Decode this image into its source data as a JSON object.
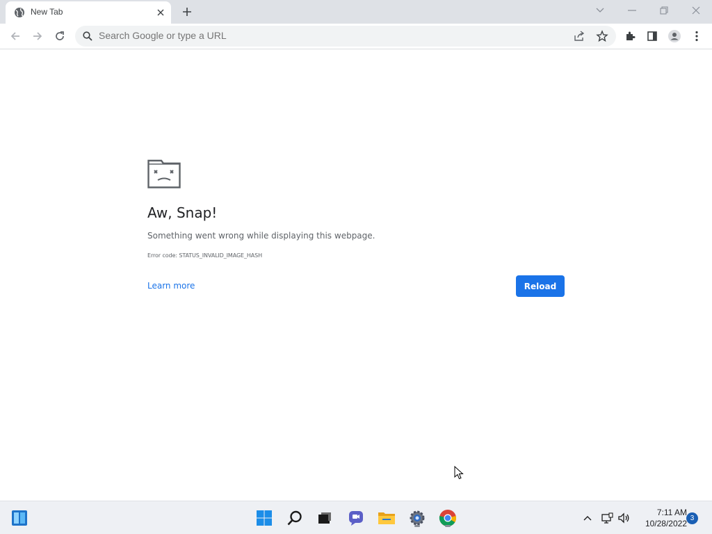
{
  "browser": {
    "tab": {
      "title": "New Tab",
      "favicon": "globe-icon"
    },
    "omnibox": {
      "placeholder": "Search Google or type a URL",
      "value": ""
    }
  },
  "error_page": {
    "heading": "Aw, Snap!",
    "message": "Something went wrong while displaying this webpage.",
    "error_code": "Error code: STATUS_INVALID_IMAGE_HASH",
    "learn_more": "Learn more",
    "reload_label": "Reload",
    "accent_color": "#1a73e8"
  },
  "taskbar": {
    "apps": [
      "widgets-icon",
      "start-icon",
      "search-icon",
      "task-view-icon",
      "chat-icon",
      "file-explorer-icon",
      "settings-icon",
      "chrome-icon"
    ],
    "time": "7:11 AM",
    "date": "10/28/2022",
    "notification_count": "3"
  }
}
